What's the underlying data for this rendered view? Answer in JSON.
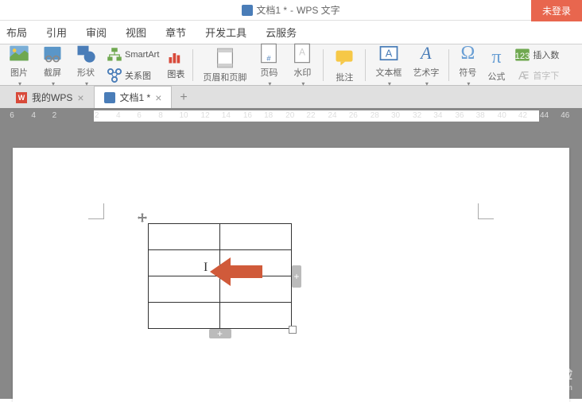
{
  "title": {
    "document_name": "文档1 *",
    "app_name": "WPS 文字"
  },
  "login_button": "未登录",
  "menu": {
    "layout": "布局",
    "reference": "引用",
    "review": "审阅",
    "view": "视图",
    "section": "章节",
    "dev_tools": "开发工具",
    "cloud": "云服务"
  },
  "toolbar": {
    "picture": "图片",
    "screenshot": "截屏",
    "shape": "形状",
    "smartart": "SmartArt",
    "chart": "图表",
    "relation": "关系图",
    "header_footer": "页眉和页脚",
    "page_number": "页码",
    "watermark": "水印",
    "annotation": "批注",
    "textbox": "文本框",
    "wordart": "艺术字",
    "symbol": "符号",
    "formula": "公式",
    "insert_number": "插入数",
    "first_char": "首字下"
  },
  "tabs": {
    "wps_home": "我的WPS",
    "doc1": "文档1 *"
  },
  "ruler_numbers": [
    "6",
    "4",
    "2",
    "2",
    "4",
    "6",
    "8",
    "10",
    "12",
    "14",
    "16",
    "18",
    "20",
    "22",
    "24",
    "26",
    "28",
    "30",
    "32",
    "34",
    "36",
    "38",
    "40",
    "42",
    "44",
    "46"
  ],
  "watermark_text": {
    "main": "Baidu经验",
    "sub": "jingyan.baidu.com"
  },
  "colors": {
    "accent_orange": "#e8664e",
    "arrow_color": "#d05a3a",
    "link_blue": "#4a7db8"
  }
}
